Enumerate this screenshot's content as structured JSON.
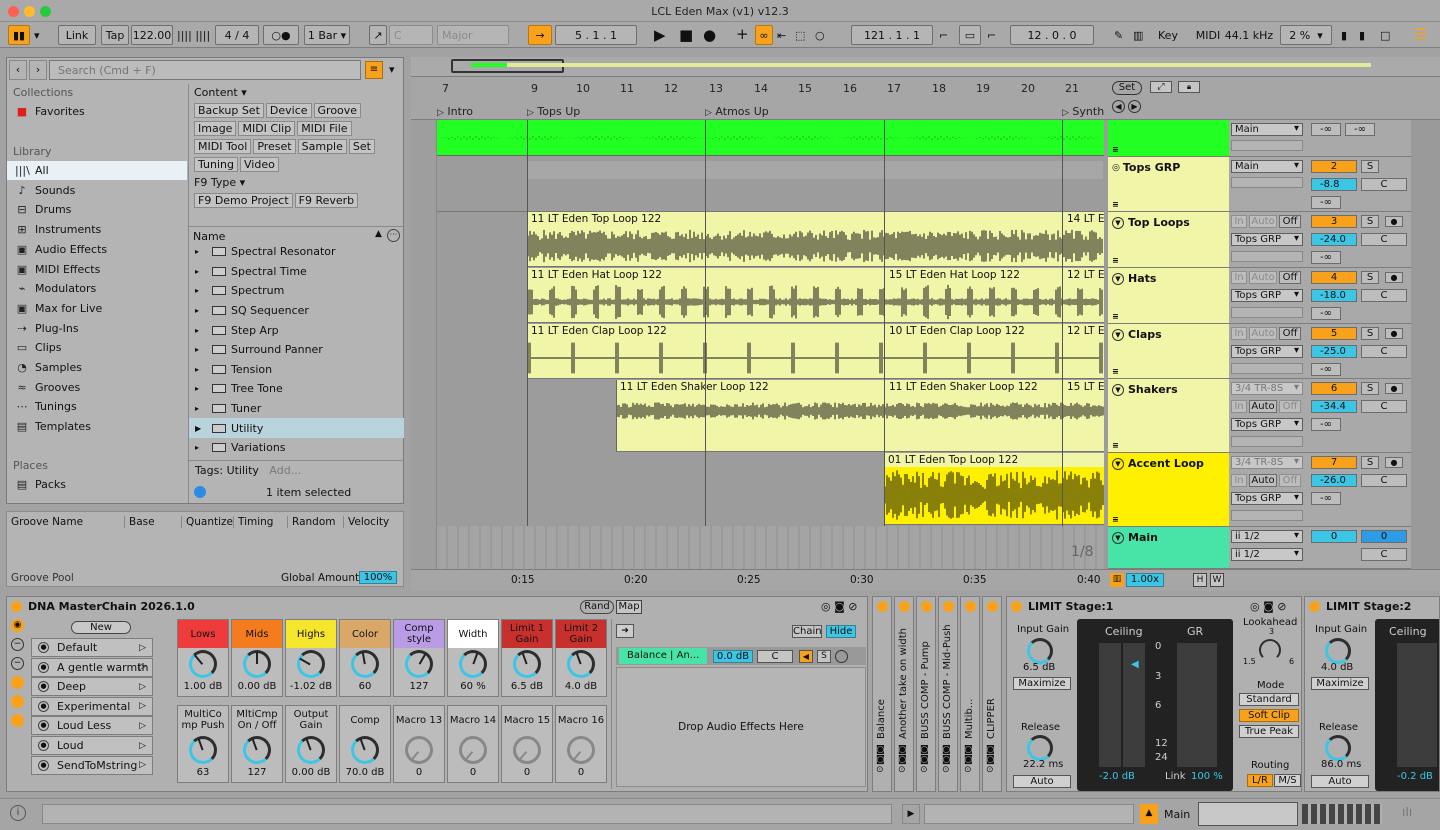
{
  "window": {
    "title": "LCL Eden Max (v1) v12.3"
  },
  "colors": {
    "orange": "#f7a21a",
    "cyan": "#3bc6e6",
    "green_clip": "#22ff22",
    "yellow_clip": "#f0f5a8",
    "accent_yellow": "#fff000"
  },
  "toolbar": {
    "link": "Link",
    "tap": "Tap",
    "tempo": "122.00",
    "sig_num": "4",
    "sig_den": "4",
    "metro": "○●",
    "quantize": "1 Bar",
    "key": "C",
    "scale": "Major",
    "position": "5 .  1 .  1",
    "loop_start": "121 .  1 .  1",
    "loop_len": "12 .  0 .  0",
    "key_label": "Key",
    "midi_label": "MIDI",
    "sample_rate": "44.1 kHz",
    "cpu": "2 %"
  },
  "browser": {
    "search_placeholder": "Search (Cmd + F)",
    "collections_label": "Collections",
    "favorites": "Favorites",
    "library_label": "Library",
    "library": [
      "All",
      "Sounds",
      "Drums",
      "Instruments",
      "Audio Effects",
      "MIDI Effects",
      "Modulators",
      "Max for Live",
      "Plug-Ins",
      "Clips",
      "Samples",
      "Grooves",
      "Tunings",
      "Templates"
    ],
    "places_label": "Places",
    "packs": "Packs",
    "content_label": "Content ▾",
    "content_tags": [
      "Backup Set",
      "Device",
      "Groove",
      "Image",
      "MIDI Clip",
      "MIDI File",
      "MIDI Tool",
      "Preset",
      "Sample",
      "Set",
      "Tuning",
      "Video"
    ],
    "f9_label": "F9 Type ▾",
    "f9_tags": [
      "F9 Demo Project",
      "F9 Reverb"
    ],
    "name_header": "Name",
    "items": [
      "Spectral Resonator",
      "Spectral Time",
      "Spectrum",
      "SQ Sequencer",
      "Step Arp",
      "Surround Panner",
      "Tension",
      "Tree Tone",
      "Tuner",
      "Utility",
      "Variations"
    ],
    "tags_label": "Tags:",
    "tag_value": "Utility",
    "tag_add": "Add...",
    "status": "1 item selected"
  },
  "groove": {
    "cols": [
      "Groove Name",
      "Base",
      "Quantize",
      "Timing",
      "Random",
      "Velocity"
    ],
    "pool": "Groove Pool",
    "global_amount_label": "Global Amount",
    "global_amount": "100%"
  },
  "arrangement": {
    "bars": [
      "7",
      "9",
      "10",
      "11",
      "12",
      "13",
      "14",
      "15",
      "16",
      "17",
      "18",
      "19",
      "20",
      "21"
    ],
    "locators": [
      "Intro",
      "Tops Up",
      "Atmos Up",
      "Synth"
    ],
    "set_button": "Set",
    "times": [
      "0:15",
      "0:20",
      "0:25",
      "0:30",
      "0:35",
      "0:40"
    ],
    "zoom_fraction": "1/8",
    "zoom": "1.00x",
    "clips": {
      "top_a": "11 LT Eden Top Loop 122",
      "top_b": "14 LT Ed",
      "hat_a": "11 LT Eden Hat Loop 122",
      "hat_b": "15 LT Eden Hat Loop 122",
      "hat_c": "12 LT Ed",
      "clap_a": "11 LT Eden Clap Loop 122",
      "clap_b": "10 LT Eden Clap Loop 122",
      "clap_c": "12 LT E",
      "shaker_a": "11 LT Eden Shaker Loop 122",
      "shaker_b": "11 LT Eden Shaker Loop 122",
      "shaker_c": "15 LT E",
      "accent_a": "01 LT Eden Top Loop 122"
    },
    "tracks": [
      {
        "name": "",
        "route": "Main",
        "num": "",
        "vol": "-∞",
        "pan": "-∞"
      },
      {
        "name": "Tops GRP",
        "route": "Main",
        "num": "2",
        "vol": "-8.8",
        "pan": "C"
      },
      {
        "name": "Top Loops",
        "route": "Tops GRP",
        "num": "3",
        "vol": "-24.0",
        "pan": "C"
      },
      {
        "name": "Hats",
        "route": "Tops GRP",
        "num": "4",
        "vol": "-18.0",
        "pan": "C"
      },
      {
        "name": "Claps",
        "route": "Tops GRP",
        "num": "5",
        "vol": "-25.0",
        "pan": "C"
      },
      {
        "name": "Shakers",
        "input": "3/4 TR-8S",
        "route": "Tops GRP",
        "num": "6",
        "vol": "-34.4",
        "pan": "C"
      },
      {
        "name": "Accent Loop",
        "input": "3/4 TR-8S",
        "route": "Tops GRP",
        "num": "7",
        "vol": "-26.0",
        "pan": "C"
      },
      {
        "name": "Main",
        "input": "ii 1/2",
        "route": "ii 1/2",
        "num": "0",
        "vol": "0",
        "pan": "C"
      }
    ],
    "in_label": "In",
    "auto_label": "Auto",
    "off_label": "Off",
    "s_label": "S",
    "neg_inf": "-∞",
    "h_btn": "H",
    "w_btn": "W"
  },
  "device": {
    "rack_name": "DNA MasterChain 2026.1.0",
    "rand": "Rand",
    "map": "Map",
    "new": "New",
    "presets": [
      "Default",
      "A gentle warmth",
      "Deep",
      "Experimental",
      "Loud Less",
      "Loud",
      "SendToMstring"
    ],
    "macros_top": [
      {
        "label": "Lows",
        "value": "1.00 dB",
        "color": "#ee3b3b"
      },
      {
        "label": "Mids",
        "value": "0.00 dB",
        "color": "#f47b1e"
      },
      {
        "label": "Highs",
        "value": "-1.02 dB",
        "color": "#f5e52c"
      },
      {
        "label": "Color",
        "value": "60",
        "color": "#d9a869"
      },
      {
        "label": "Comp style",
        "value": "127",
        "color": "#b99be6"
      },
      {
        "label": "Width",
        "value": "60 %",
        "color": "#ffffff"
      },
      {
        "label": "Limit 1 Gain",
        "value": "6.5 dB",
        "color": "#c8302e"
      },
      {
        "label": "Limit 2 Gain",
        "value": "4.0 dB",
        "color": "#c8302e"
      }
    ],
    "macros_bottom": [
      {
        "label": "MultiCo mp Push",
        "value": "63"
      },
      {
        "label": "MltiCmp On / Off",
        "value": "127"
      },
      {
        "label": "Output Gain",
        "value": "0.00 dB"
      },
      {
        "label": "Comp",
        "value": "70.0 dB"
      },
      {
        "label": "Macro 13",
        "value": "0"
      },
      {
        "label": "Macro 14",
        "value": "0"
      },
      {
        "label": "Macro 15",
        "value": "0"
      },
      {
        "label": "Macro 16",
        "value": "0"
      }
    ],
    "chain_label": "Chain",
    "hide_label": "Hide",
    "chain_name": "Balance | An...",
    "chain_vol": "0.0 dB",
    "chain_pan": "C",
    "chain_s": "S",
    "drop_text": "Drop Audio Effects Here",
    "inner_devices": [
      "Balance",
      "Another take on width",
      "BUSS COMP - Pump",
      "BUSS COMP - Mid-Push",
      "Multib...",
      "CLIPPER"
    ]
  },
  "limiter1": {
    "title": "LIMIT Stage:1",
    "input_gain_label": "Input Gain",
    "input_gain": "6.5 dB",
    "maximize": "Maximize",
    "ceiling_label": "Ceiling",
    "gr_label": "GR",
    "scale": [
      "0",
      "3",
      "6",
      "12",
      "24"
    ],
    "release_label": "Release",
    "release": "22.2 ms",
    "auto": "Auto",
    "ceiling": "-2.0 dB",
    "link_label": "Link",
    "link": "100 %",
    "lookahead_label": "Lookahead",
    "lookahead_marks": [
      "3",
      "1.5",
      "6"
    ],
    "mode_label": "Mode",
    "mode_standard": "Standard",
    "mode_soft": "Soft Clip",
    "mode_true": "True Peak",
    "routing_label": "Routing",
    "routing_lr": "L/R",
    "routing_ms": "M/S"
  },
  "limiter2": {
    "title": "LIMIT Stage:2",
    "input_gain_label": "Input Gain",
    "input_gain": "4.0 dB",
    "maximize": "Maximize",
    "ceiling_label": "Ceiling",
    "release_label": "Release",
    "release": "86.0 ms",
    "auto": "Auto",
    "ceiling": "-0.2 dB"
  },
  "statusbar": {
    "track": "Main"
  }
}
